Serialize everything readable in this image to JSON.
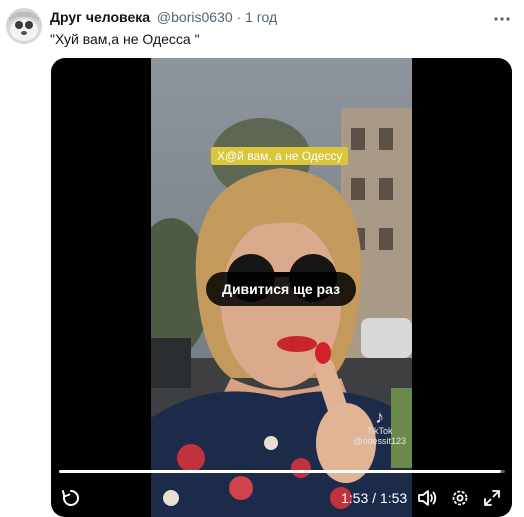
{
  "author": {
    "display_name": "Друг человека",
    "handle": "@boris0630",
    "separator": "·",
    "time": "1 год"
  },
  "tweet": {
    "text": "\"Хуй вам,а не Одесса \""
  },
  "media": {
    "video_caption": "Х@й вам, а не Одессу",
    "replay_label": "Дивитися ще раз",
    "watermark": {
      "brand": "TikTok",
      "user": "@odessit123"
    },
    "player": {
      "time_readout": "1:53 / 1:53",
      "progress": 0.99
    }
  },
  "icons": {
    "more": "more-horizontal-icon",
    "replay": "replay-icon",
    "volume": "volume-icon",
    "settings": "settings-gear-icon",
    "fullscreen": "fullscreen-icon"
  }
}
